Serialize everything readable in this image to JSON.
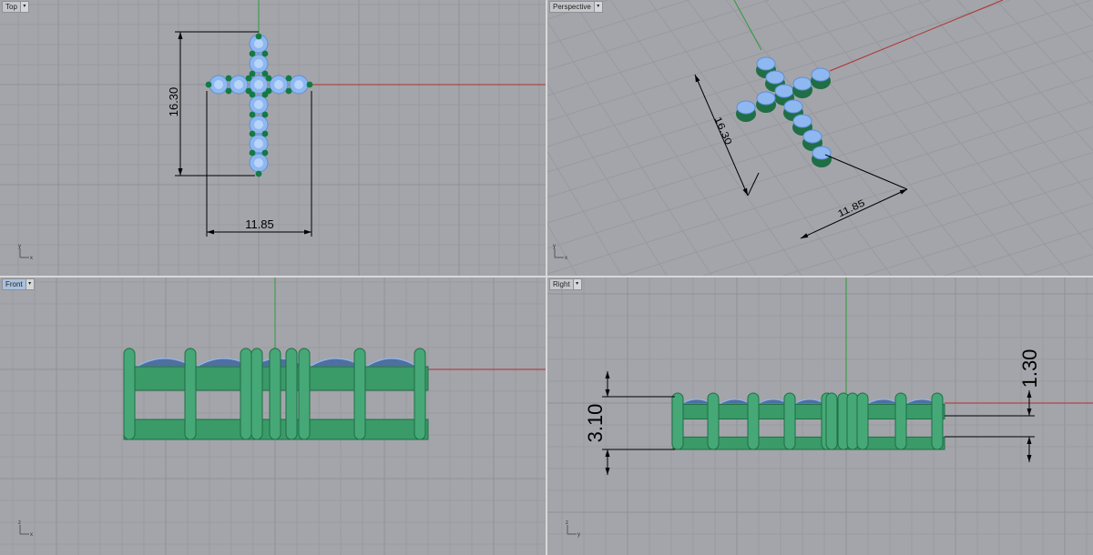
{
  "viewports": [
    {
      "id": "top",
      "label": "Top"
    },
    {
      "id": "perspective",
      "label": "Perspective"
    },
    {
      "id": "front",
      "label": "Front"
    },
    {
      "id": "right",
      "label": "Right"
    }
  ],
  "dimensions": {
    "top_height": "16.30",
    "top_width": "11.85",
    "persp_height": "16.30",
    "persp_width": "11.85",
    "right_total": "3.10",
    "right_top": "1.30"
  },
  "axis_labels": {
    "x": "x",
    "y": "y",
    "z": "z"
  },
  "colors": {
    "background": "#a3a5aa",
    "grid": "#989a9f",
    "grid_major": "#8f9196",
    "x_axis": "#b03030",
    "y_axis": "#2f9a3a",
    "metal": "#3a9a68",
    "metal_dark": "#1f6e45",
    "gem": "#8fb8f0",
    "gem_edge": "#5f8fd8",
    "prong": "#127a45"
  }
}
